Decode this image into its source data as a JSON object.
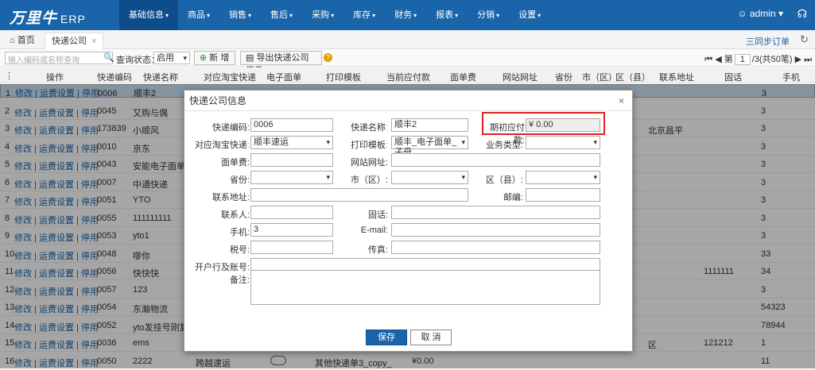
{
  "brand": {
    "logo": "万里牛",
    "suffix": "ERP"
  },
  "nav": [
    "基础信息",
    "商品",
    "销售",
    "售后",
    "采购",
    "库存",
    "财务",
    "报表",
    "分销",
    "设置"
  ],
  "user": "admin",
  "tabs": {
    "home": "首页",
    "current": "快递公司"
  },
  "sync": "三同步订单",
  "toolbar": {
    "search_placeholder": "输入编码或名称查询",
    "status_label": "查询状态：",
    "status_value": "启用",
    "add": "新 增",
    "export": "导出快递公司信息"
  },
  "pager": {
    "page_label": "第",
    "page": "1",
    "total": "/3(共50笔)"
  },
  "columns": [
    "操作",
    "快递编码",
    "快递名称",
    "对应淘宝快递",
    "电子面单",
    "打印模板",
    "当前应付款",
    "面单费",
    "网站网址",
    "省份",
    "市（区）",
    "区（县）",
    "联系地址",
    "固话",
    "手机"
  ],
  "ops": "修改 | 运费设置 | 停用",
  "rows": [
    {
      "n": "1",
      "code": "0006",
      "name": "顺丰2",
      "addr": "",
      "tel": "",
      "mobile": "3"
    },
    {
      "n": "2",
      "code": "0045",
      "name": "又购与偶",
      "addr": "",
      "tel": "",
      "mobile": "3"
    },
    {
      "n": "3",
      "code": "173839",
      "name": "小顺风",
      "addr": "北京昌平",
      "tel": "",
      "mobile": "3"
    },
    {
      "n": "4",
      "code": "0010",
      "name": "京东",
      "addr": "",
      "tel": "",
      "mobile": "3"
    },
    {
      "n": "5",
      "code": "0043",
      "name": "安能电子面单",
      "addr": "",
      "tel": "",
      "mobile": "3"
    },
    {
      "n": "6",
      "code": "0007",
      "name": "中通快递",
      "addr": "",
      "tel": "",
      "mobile": "3"
    },
    {
      "n": "7",
      "code": "0051",
      "name": "YTO",
      "addr": "",
      "tel": "",
      "mobile": "3"
    },
    {
      "n": "8",
      "code": "0055",
      "name": "111111111",
      "addr": "",
      "tel": "",
      "mobile": "3"
    },
    {
      "n": "9",
      "code": "0053",
      "name": "yto1",
      "addr": "",
      "tel": "",
      "mobile": "3"
    },
    {
      "n": "10",
      "code": "0048",
      "name": "嗲你",
      "addr": "",
      "tel": "",
      "mobile": "33"
    },
    {
      "n": "11",
      "code": "0056",
      "name": "快快快",
      "addr": "",
      "tel": "1111111",
      "mobile": "34"
    },
    {
      "n": "12",
      "code": "0057",
      "name": "123",
      "addr": "",
      "tel": "",
      "mobile": "3"
    },
    {
      "n": "13",
      "code": "0054",
      "name": "东瀚物流",
      "addr": "",
      "tel": "",
      "mobile": "54323"
    },
    {
      "n": "14",
      "code": "0052",
      "name": "yto发挂号刚复演",
      "addr": "",
      "tel": "",
      "mobile": "78944"
    },
    {
      "n": "15",
      "code": "0036",
      "name": "ems",
      "addr": "区",
      "tel": "121212",
      "mobile": "1"
    },
    {
      "n": "16",
      "code": "0050",
      "name": "2222",
      "addr": "",
      "tel": "",
      "mobile": "11"
    }
  ],
  "row16_extra": {
    "taobao": "跨越速运",
    "tpl": "其他快递单3_copy_",
    "pay": "¥0.00"
  },
  "dialog": {
    "title": "快递公司信息",
    "code_label": "快递编码:",
    "code": "0006",
    "name_label": "快递名称",
    "name": "顺丰2",
    "prepay_label": "期初应付款:",
    "prepay": "¥ 0.00",
    "taobao_label": "对应淘宝快递",
    "taobao": "顺丰速运",
    "tpl_label": "打印模板",
    "tpl": "顺丰_电子面单_子母",
    "biz_label": "业务类型:",
    "fee_label": "面单费:",
    "site_label": "网站网址:",
    "prov_label": "省份:",
    "city_label": "市（区）:",
    "dist_label": "区（县）:",
    "addr_label": "联系地址:",
    "zip_label": "邮编:",
    "contact_label": "联系人:",
    "tel_label": "固话:",
    "mobile_label": "手机:",
    "mobile": "3",
    "email_label": "E-mail:",
    "tax_label": "税号:",
    "fax_label": "传真:",
    "bank_label": "开户行及账号:",
    "note_label": "备注:",
    "save": "保存",
    "cancel": "取 消"
  }
}
